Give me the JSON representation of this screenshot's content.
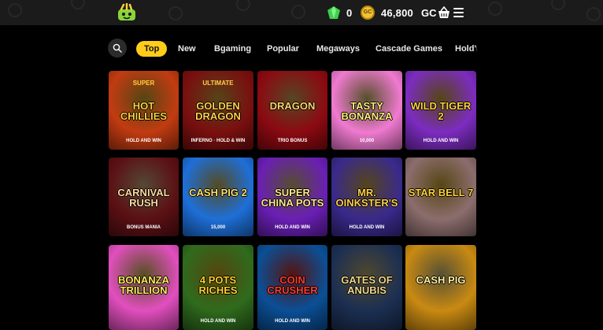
{
  "header": {
    "gems": "0",
    "coin_badge": "GC",
    "gc_amount": "46,800",
    "gc_label": "GC"
  },
  "filters": {
    "tabs": [
      "Top",
      "New",
      "Bgaming",
      "Popular",
      "Megaways",
      "Cascade Games",
      "Hold'n"
    ]
  },
  "games": [
    {
      "title": "HOT CHILLIES",
      "top": "SUPER",
      "sub": "HOLD AND WIN",
      "bg": "#c23b11",
      "accent": "#ffd23a"
    },
    {
      "title": "GOLDEN DRAGON",
      "top": "ULTIMATE",
      "sub": "INFERNO · HOLD & WIN",
      "bg": "#7a0f0f",
      "accent": "#ffcf4a"
    },
    {
      "title": "DRAGON",
      "top": "",
      "sub": "TRIO BONUS",
      "bg": "#8c0a12",
      "accent": "#ffd56b"
    },
    {
      "title": "TASTY BONANZA",
      "top": "",
      "sub": "10,000",
      "bg": "#f07ad0",
      "accent": "#ffef7a"
    },
    {
      "title": "WILD TIGER 2",
      "top": "",
      "sub": "HOLD AND WIN",
      "bg": "#7c2cc0",
      "accent": "#ffd23a"
    },
    {
      "title": "CARNIVAL RUSH",
      "top": "",
      "sub": "BONUS MANIA",
      "bg": "#5b1014",
      "accent": "#ffd9a0"
    },
    {
      "title": "CASH PIG 2",
      "top": "",
      "sub": "15,000",
      "bg": "#1e6fd8",
      "accent": "#ffe066"
    },
    {
      "title": "SUPER CHINA POTS",
      "top": "",
      "sub": "HOLD AND WIN",
      "bg": "#6a1fb5",
      "accent": "#ffe98a"
    },
    {
      "title": "MR. OINKSTER'S",
      "top": "",
      "sub": "HOLD AND WIN",
      "bg": "#3a2a8c",
      "accent": "#ffcf4a"
    },
    {
      "title": "STAR BELL 7",
      "top": "",
      "sub": "",
      "bg": "#8c6d6d",
      "accent": "#ffd23a"
    },
    {
      "title": "BONANZA TRILLION",
      "top": "",
      "sub": "",
      "bg": "#e24fbf",
      "accent": "#ffec5c"
    },
    {
      "title": "4 POTS RICHES",
      "top": "",
      "sub": "HOLD AND WIN",
      "bg": "#2f6b1d",
      "accent": "#ffcf2a"
    },
    {
      "title": "COIN CRUSHER",
      "top": "",
      "sub": "HOLD AND WIN",
      "bg": "#0b4f96",
      "accent": "#ff3b2e"
    },
    {
      "title": "GATES OF ANUBIS",
      "top": "",
      "sub": "",
      "bg": "#1c2f52",
      "accent": "#f0d78a"
    },
    {
      "title": "CASH PIG",
      "top": "",
      "sub": "",
      "bg": "#c98a12",
      "accent": "#fff0a0"
    }
  ]
}
